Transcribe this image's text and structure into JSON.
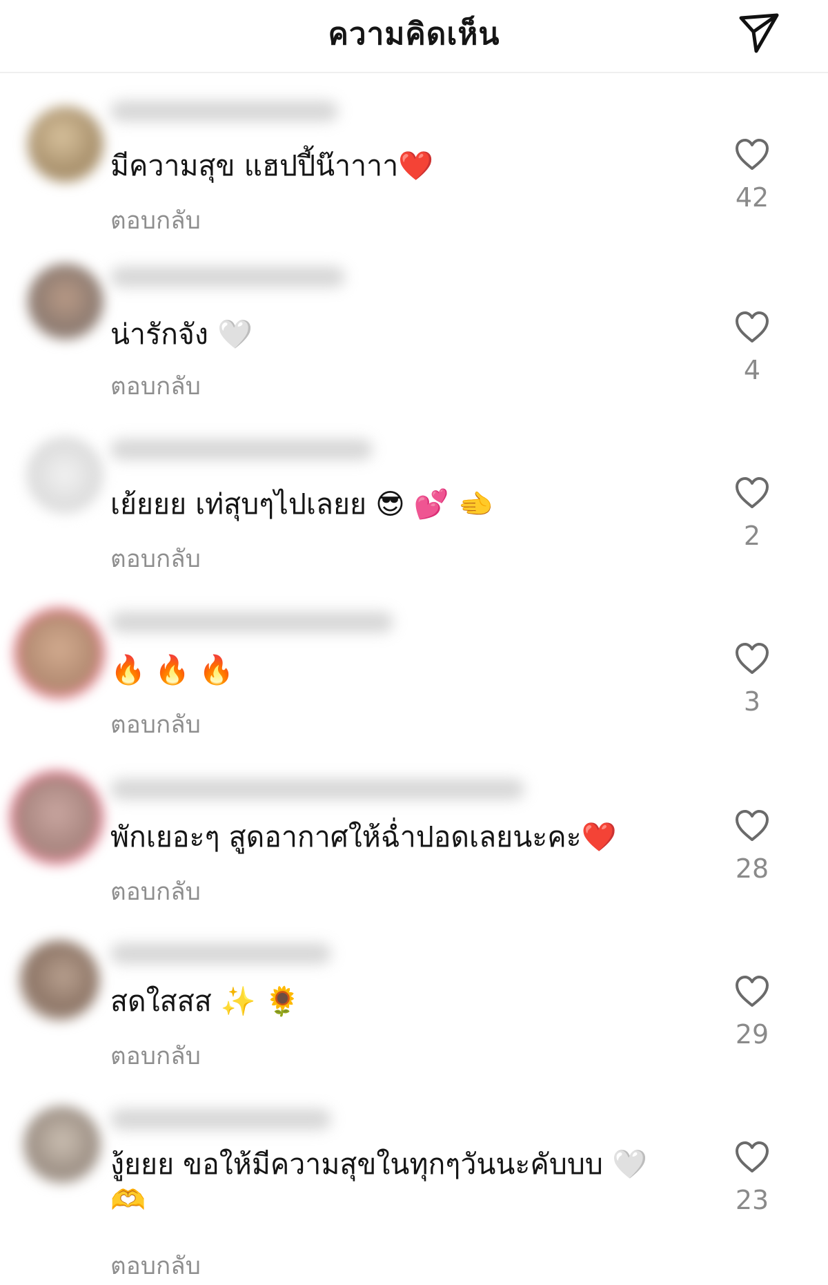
{
  "header": {
    "title": "ความคิดเห็น",
    "send_icon": "paper-plane-icon"
  },
  "comments": [
    {
      "text": "มีความสุข แฮปปี้น๊าาาา❤️",
      "reply": "ตอบกลับ",
      "likes": "42"
    },
    {
      "text": "น่ารักจัง 🤍",
      "reply": "ตอบกลับ",
      "likes": "4"
    },
    {
      "text": "เย้ยยย เท่สุบๆไปเลยย 😎 💕 🫲",
      "reply": "ตอบกลับ",
      "likes": "2"
    },
    {
      "text": "🔥 🔥 🔥",
      "reply": "ตอบกลับ",
      "likes": "3"
    },
    {
      "text": "พักเยอะๆ  สูดอากาศให้ฉ่ำปอดเลยนะคะ❤️",
      "reply": "ตอบกลับ",
      "likes": "28"
    },
    {
      "text": "สดใสสส ✨ 🌻",
      "reply": "ตอบกลับ",
      "likes": "29"
    },
    {
      "text": "งู้ยยย ขอให้มีความสุขในทุกๆวันนะคับบบ 🤍 🫶",
      "reply": "ตอบกลับ",
      "likes": "23"
    }
  ],
  "colors": {
    "text": "#151515",
    "muted": "#8e8e8e",
    "story_ring": "#e64a6b"
  }
}
